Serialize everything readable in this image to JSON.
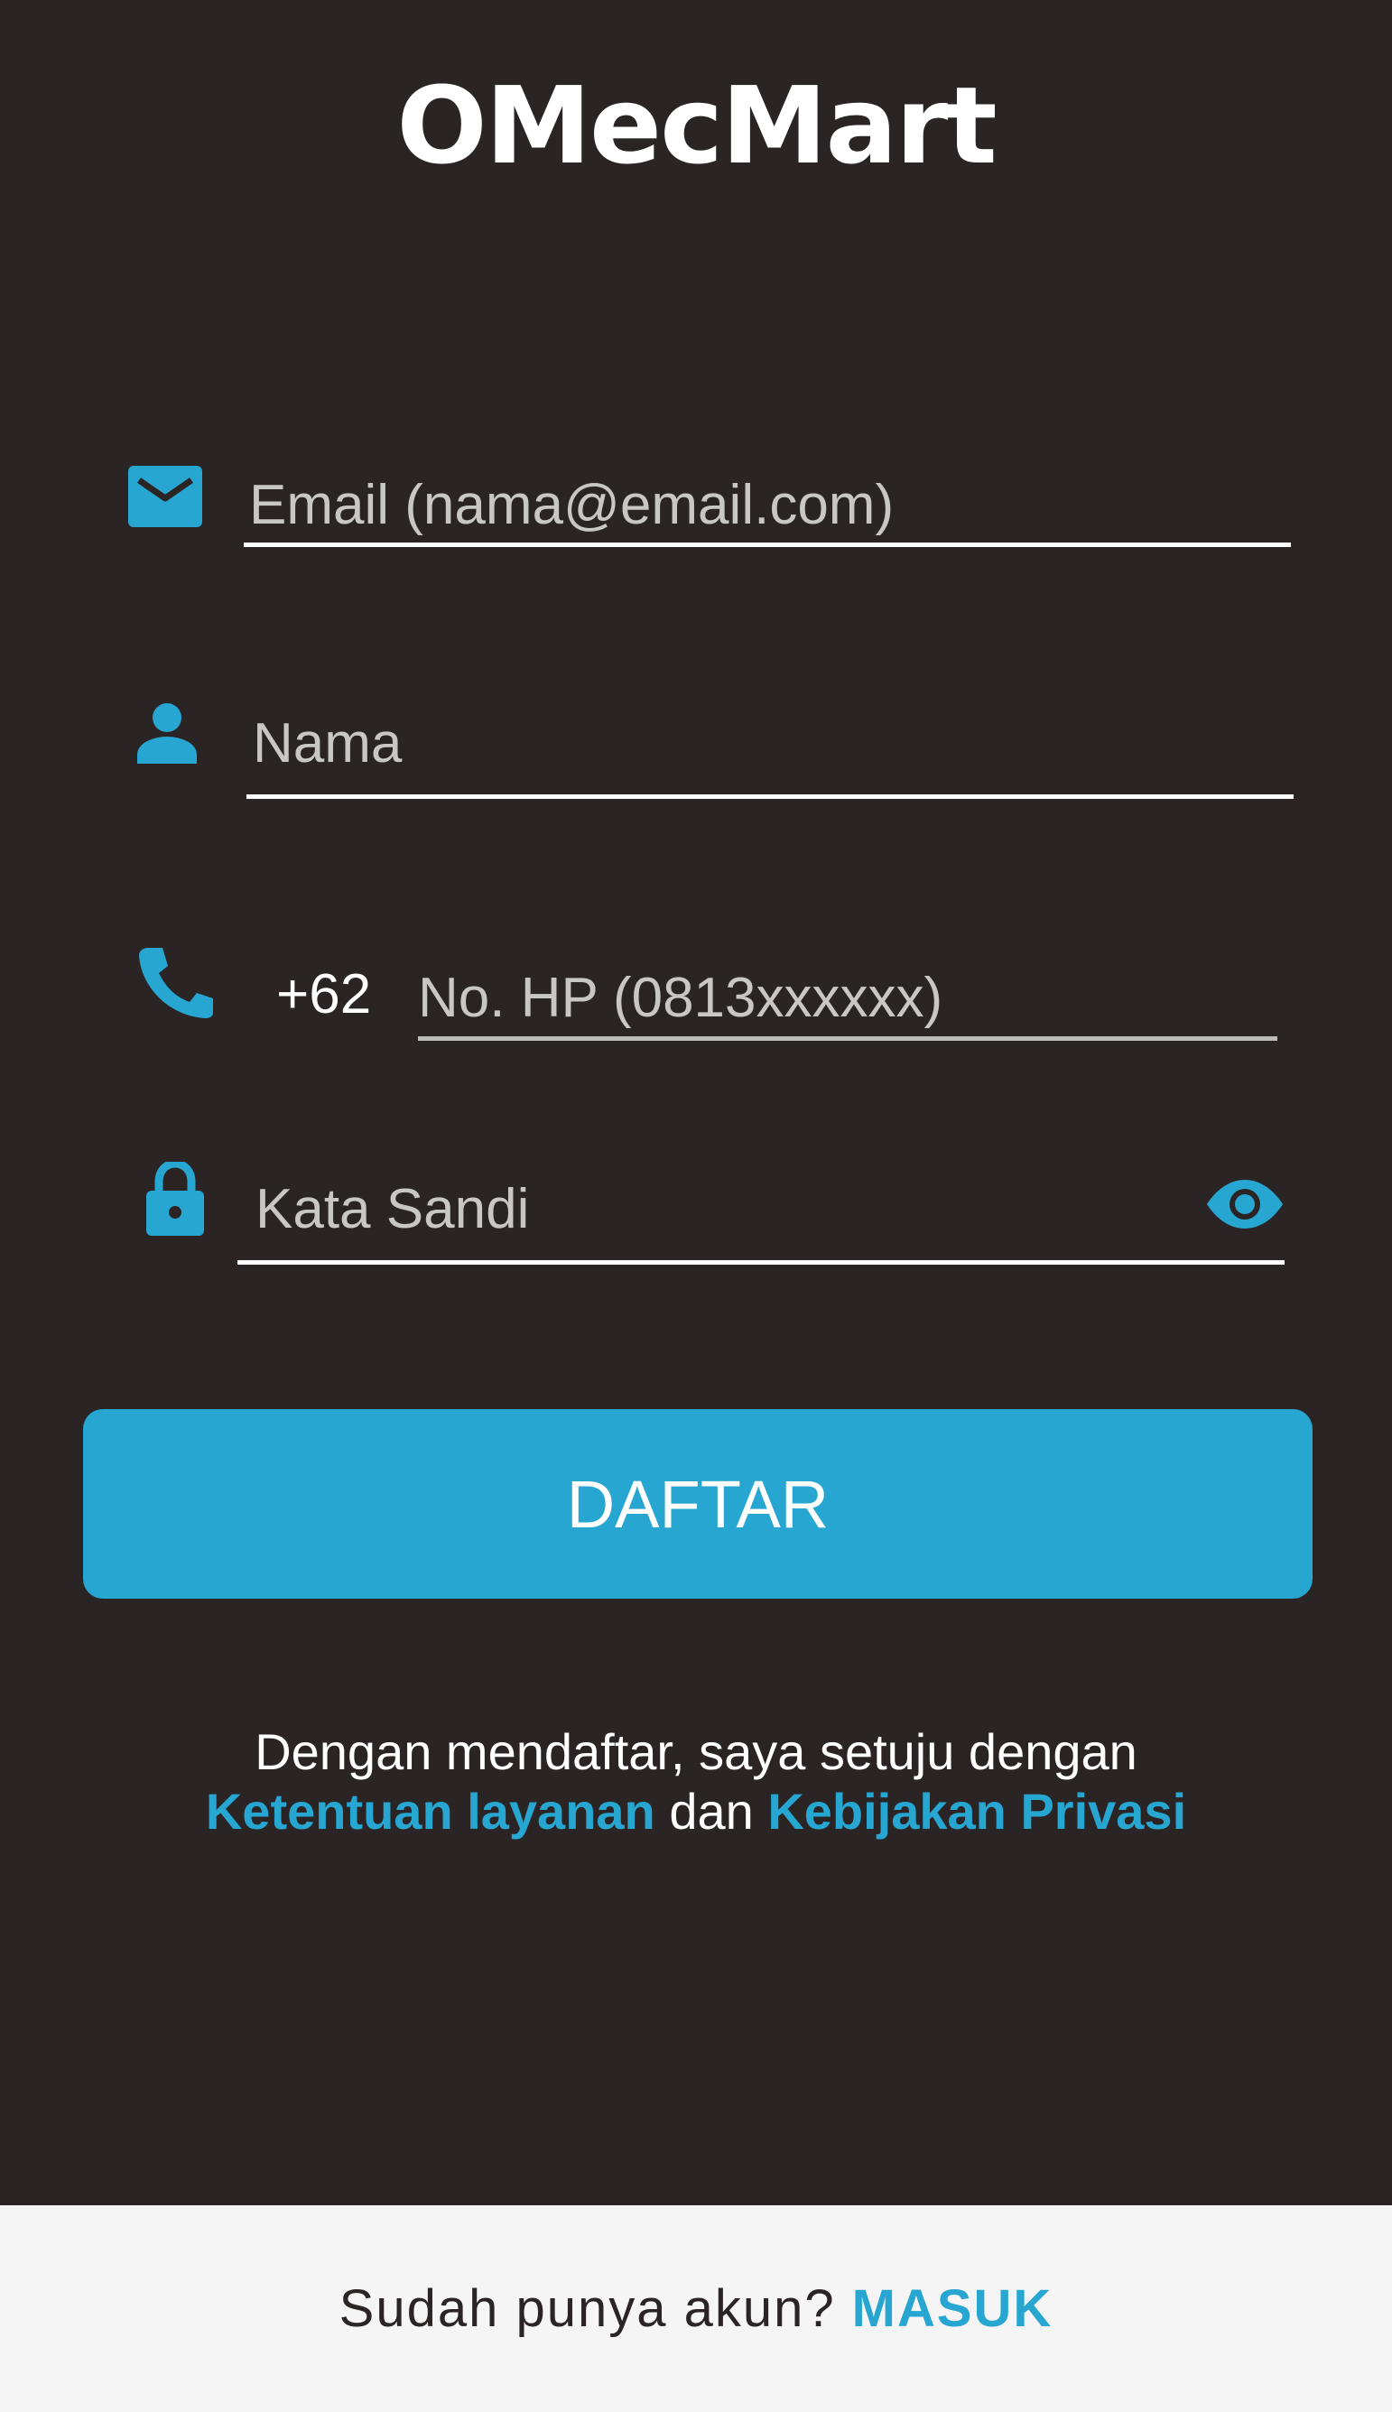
{
  "app": {
    "title": "OMecMart"
  },
  "form": {
    "email_placeholder": "Email (nama@email.com)",
    "name_placeholder": "Nama",
    "phone_prefix": "+62",
    "phone_placeholder": "No. HP (0813xxxxxx)",
    "password_placeholder": "Kata Sandi"
  },
  "actions": {
    "register_label": "DAFTAR"
  },
  "terms": {
    "line1": "Dengan mendaftar, saya setuju dengan",
    "terms_link": "Ketentuan layanan",
    "and": "dan",
    "privacy_link": "Kebijakan Privasi"
  },
  "footer": {
    "prompt": "Sudah punya akun?",
    "login_link": "MASUK"
  },
  "icons": {
    "email": "mail-icon",
    "name": "person-icon",
    "phone": "phone-icon",
    "password": "lock-icon",
    "visibility": "eye-icon"
  },
  "colors": {
    "background": "#2b2425",
    "accent": "#26a6d1",
    "footer_bg": "#f5f5f5"
  }
}
